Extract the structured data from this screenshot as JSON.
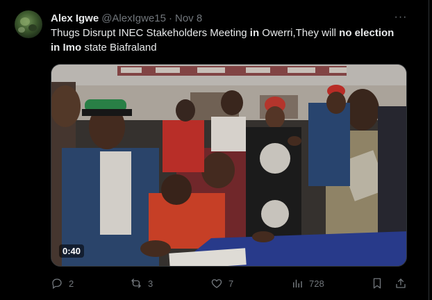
{
  "author": {
    "display_name": "Alex Igwe",
    "handle": "@AlexIgwe15",
    "separator": "·",
    "date": "Nov 8",
    "avatar_icon": "profile-photo"
  },
  "more_icon": "ellipsis-icon",
  "tweet": {
    "parts": [
      {
        "text": "Thugs Disrupt INEC Stakeholders Meeting ",
        "bold": false
      },
      {
        "text": "in",
        "bold": true
      },
      {
        "text": " Owerri,They will ",
        "bold": false
      },
      {
        "text": "no election",
        "bold": true
      },
      {
        "text": "in Imo",
        "bold": true
      },
      {
        "text": " state Biafraland",
        "bold": false
      }
    ]
  },
  "media": {
    "type": "video",
    "duration": "0:40"
  },
  "actions": {
    "reply": {
      "icon": "reply-icon",
      "count": "2"
    },
    "repost": {
      "icon": "repost-icon",
      "count": "3"
    },
    "like": {
      "icon": "heart-icon",
      "count": "7"
    },
    "views": {
      "icon": "views-icon",
      "count": "728"
    },
    "bookmark": {
      "icon": "bookmark-icon"
    },
    "share": {
      "icon": "share-icon"
    }
  },
  "colors": {
    "background": "#000000",
    "text_primary": "#e7e9ea",
    "text_secondary": "#71767b",
    "border": "#2f3336"
  }
}
